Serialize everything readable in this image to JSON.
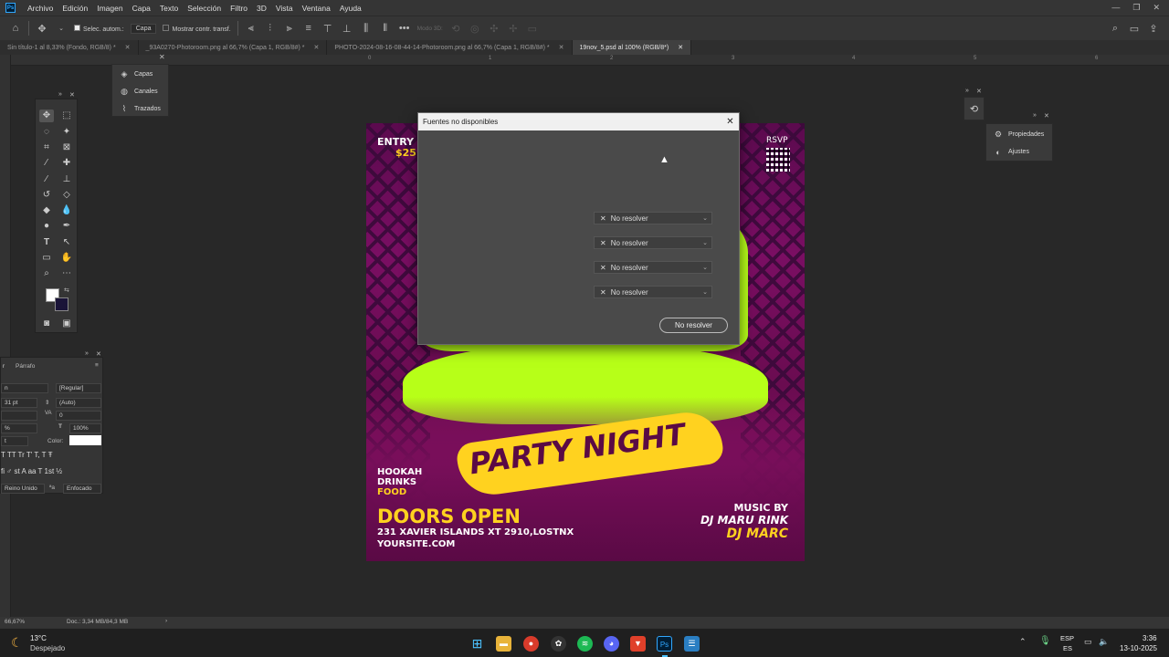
{
  "menubar": {
    "logo": "Ps",
    "items": [
      "Archivo",
      "Edición",
      "Imagen",
      "Capa",
      "Texto",
      "Selección",
      "Filtro",
      "3D",
      "Vista",
      "Ventana",
      "Ayuda"
    ]
  },
  "optbar": {
    "auto_select": "Selec. autom.:",
    "layer_select": "Capa",
    "show_transform": "Mostrar contr. transf.",
    "mode_3d": "Modo 3D:"
  },
  "tabs": [
    "Sin título-1 al 8,33% (Fondo, RGB/8) *",
    "_93A0270-Photoroom.png al 66,7% (Capa 1, RGB/8#) *",
    "PHOTO-2024-08-16-08-44-14-Photoroom.png al 66,7% (Capa 1, RGB/8#) *",
    "19nov_5.psd al 100% (RGB/8*)"
  ],
  "ruler": [
    "0",
    "1",
    "2",
    "3",
    "4",
    "5",
    "6",
    "7",
    "8"
  ],
  "layers_panel": {
    "items": [
      "Capas",
      "Canales",
      "Trazados"
    ]
  },
  "props_panel": {
    "items": [
      "Propiedades",
      "Ajustes"
    ]
  },
  "char_panel": {
    "tab_paragraph": "Párrafo",
    "font_style": "[Regular]",
    "size": "31 pt",
    "leading": "(Auto)",
    "kerning": "0",
    "scale": "100%",
    "color_label": "Color:",
    "language": "Reino Unido",
    "antialias": "Enfocado",
    "styles_row": "T TT Tr T' T, T Ŧ",
    "opentype_row": "fi ♂ st A aa T 1st ½"
  },
  "poster": {
    "entry": "ENTRY",
    "price": "$25",
    "rsvp": "RSVP",
    "party_night": "PARTY NIGHT",
    "hookah": "HOOKAH",
    "drinks": "DRINKS",
    "food": "FOOD",
    "doors_open": "DOORS OPEN",
    "address": "231 XAVIER ISLANDS XT 2910,LOSTNX",
    "site": "YOURSITE.COM",
    "music_by": "MUSIC BY",
    "dj1": "DJ MARU RINK",
    "dj2": "DJ MARC"
  },
  "dialog": {
    "title": "Fuentes no disponibles",
    "options": [
      "No resolver",
      "No resolver",
      "No resolver",
      "No resolver"
    ],
    "button": "No resolver"
  },
  "statusbar": {
    "zoom": "66,67%",
    "doc": "Doc.: 3,34 MB/84,3 MB"
  },
  "taskbar": {
    "temp": "13°C",
    "weather": "Despejado",
    "lang1": "ESP",
    "lang2": "ES",
    "time": "3:36",
    "date": "13-10-2025"
  },
  "colors": {
    "accent_lime": "#b7ff18",
    "poster_yellow": "#ffd21f",
    "poster_magenta": "#7a0e63"
  }
}
